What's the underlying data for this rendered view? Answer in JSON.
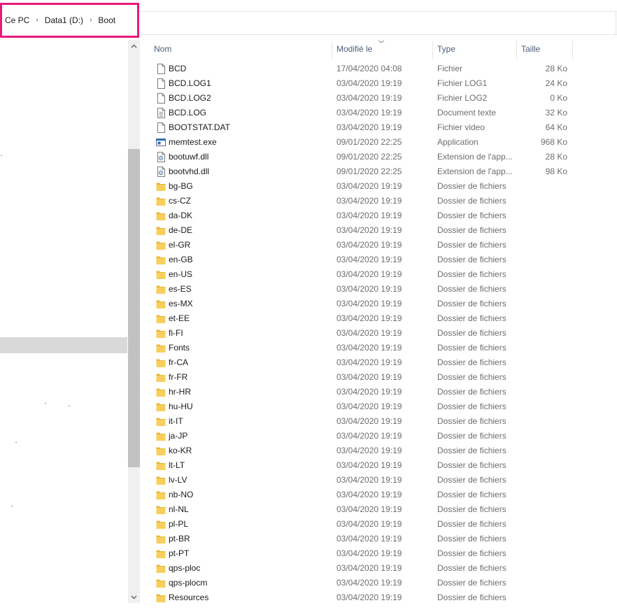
{
  "breadcrumb": {
    "items": [
      "Ce PC",
      "Data1 (D:)",
      "Boot"
    ]
  },
  "columns": {
    "name": "Nom",
    "modified": "Modifié le",
    "type": "Type",
    "size": "Taille"
  },
  "colors": {
    "highlight_box": "#e8197a",
    "folder": "#f5c84c",
    "header_text": "#4c607a"
  },
  "files": [
    {
      "name": "BCD",
      "date": "17/04/2020 04:08",
      "type": "Fichier",
      "size": "28 Ko",
      "icon": "file-icon"
    },
    {
      "name": "BCD.LOG1",
      "date": "03/04/2020 19:19",
      "type": "Fichier LOG1",
      "size": "24 Ko",
      "icon": "file-icon"
    },
    {
      "name": "BCD.LOG2",
      "date": "03/04/2020 19:19",
      "type": "Fichier LOG2",
      "size": "0 Ko",
      "icon": "file-icon"
    },
    {
      "name": "BCD.LOG",
      "date": "03/04/2020 19:19",
      "type": "Document texte",
      "size": "32 Ko",
      "icon": "text-file-icon"
    },
    {
      "name": "BOOTSTAT.DAT",
      "date": "03/04/2020 19:19",
      "type": "Fichier video",
      "size": "64 Ko",
      "icon": "file-icon"
    },
    {
      "name": "memtest.exe",
      "date": "09/01/2020 22:25",
      "type": "Application",
      "size": "968 Ko",
      "icon": "application-icon"
    },
    {
      "name": "bootuwf.dll",
      "date": "09/01/2020 22:25",
      "type": "Extension de l'app...",
      "size": "28 Ko",
      "icon": "dll-icon"
    },
    {
      "name": "bootvhd.dll",
      "date": "09/01/2020 22:25",
      "type": "Extension de l'app...",
      "size": "98 Ko",
      "icon": "dll-icon"
    },
    {
      "name": "bg-BG",
      "date": "03/04/2020 19:19",
      "type": "Dossier de fichiers",
      "size": "",
      "icon": "folder-icon"
    },
    {
      "name": "cs-CZ",
      "date": "03/04/2020 19:19",
      "type": "Dossier de fichiers",
      "size": "",
      "icon": "folder-icon"
    },
    {
      "name": "da-DK",
      "date": "03/04/2020 19:19",
      "type": "Dossier de fichiers",
      "size": "",
      "icon": "folder-icon"
    },
    {
      "name": "de-DE",
      "date": "03/04/2020 19:19",
      "type": "Dossier de fichiers",
      "size": "",
      "icon": "folder-icon"
    },
    {
      "name": "el-GR",
      "date": "03/04/2020 19:19",
      "type": "Dossier de fichiers",
      "size": "",
      "icon": "folder-icon"
    },
    {
      "name": "en-GB",
      "date": "03/04/2020 19:19",
      "type": "Dossier de fichiers",
      "size": "",
      "icon": "folder-icon"
    },
    {
      "name": "en-US",
      "date": "03/04/2020 19:19",
      "type": "Dossier de fichiers",
      "size": "",
      "icon": "folder-icon"
    },
    {
      "name": "es-ES",
      "date": "03/04/2020 19:19",
      "type": "Dossier de fichiers",
      "size": "",
      "icon": "folder-icon"
    },
    {
      "name": "es-MX",
      "date": "03/04/2020 19:19",
      "type": "Dossier de fichiers",
      "size": "",
      "icon": "folder-icon"
    },
    {
      "name": "et-EE",
      "date": "03/04/2020 19:19",
      "type": "Dossier de fichiers",
      "size": "",
      "icon": "folder-icon"
    },
    {
      "name": "fi-FI",
      "date": "03/04/2020 19:19",
      "type": "Dossier de fichiers",
      "size": "",
      "icon": "folder-icon"
    },
    {
      "name": "Fonts",
      "date": "03/04/2020 19:19",
      "type": "Dossier de fichiers",
      "size": "",
      "icon": "folder-icon"
    },
    {
      "name": "fr-CA",
      "date": "03/04/2020 19:19",
      "type": "Dossier de fichiers",
      "size": "",
      "icon": "folder-icon"
    },
    {
      "name": "fr-FR",
      "date": "03/04/2020 19:19",
      "type": "Dossier de fichiers",
      "size": "",
      "icon": "folder-icon"
    },
    {
      "name": "hr-HR",
      "date": "03/04/2020 19:19",
      "type": "Dossier de fichiers",
      "size": "",
      "icon": "folder-icon"
    },
    {
      "name": "hu-HU",
      "date": "03/04/2020 19:19",
      "type": "Dossier de fichiers",
      "size": "",
      "icon": "folder-icon"
    },
    {
      "name": "it-IT",
      "date": "03/04/2020 19:19",
      "type": "Dossier de fichiers",
      "size": "",
      "icon": "folder-icon"
    },
    {
      "name": "ja-JP",
      "date": "03/04/2020 19:19",
      "type": "Dossier de fichiers",
      "size": "",
      "icon": "folder-icon"
    },
    {
      "name": "ko-KR",
      "date": "03/04/2020 19:19",
      "type": "Dossier de fichiers",
      "size": "",
      "icon": "folder-icon"
    },
    {
      "name": "lt-LT",
      "date": "03/04/2020 19:19",
      "type": "Dossier de fichiers",
      "size": "",
      "icon": "folder-icon"
    },
    {
      "name": "lv-LV",
      "date": "03/04/2020 19:19",
      "type": "Dossier de fichiers",
      "size": "",
      "icon": "folder-icon"
    },
    {
      "name": "nb-NO",
      "date": "03/04/2020 19:19",
      "type": "Dossier de fichiers",
      "size": "",
      "icon": "folder-icon"
    },
    {
      "name": "nl-NL",
      "date": "03/04/2020 19:19",
      "type": "Dossier de fichiers",
      "size": "",
      "icon": "folder-icon"
    },
    {
      "name": "pl-PL",
      "date": "03/04/2020 19:19",
      "type": "Dossier de fichiers",
      "size": "",
      "icon": "folder-icon"
    },
    {
      "name": "pt-BR",
      "date": "03/04/2020 19:19",
      "type": "Dossier de fichiers",
      "size": "",
      "icon": "folder-icon"
    },
    {
      "name": "pt-PT",
      "date": "03/04/2020 19:19",
      "type": "Dossier de fichiers",
      "size": "",
      "icon": "folder-icon"
    },
    {
      "name": "qps-ploc",
      "date": "03/04/2020 19:19",
      "type": "Dossier de fichiers",
      "size": "",
      "icon": "folder-icon"
    },
    {
      "name": "qps-plocm",
      "date": "03/04/2020 19:19",
      "type": "Dossier de fichiers",
      "size": "",
      "icon": "folder-icon"
    },
    {
      "name": "Resources",
      "date": "03/04/2020 19:19",
      "type": "Dossier de fichiers",
      "size": "",
      "icon": "folder-icon"
    }
  ]
}
